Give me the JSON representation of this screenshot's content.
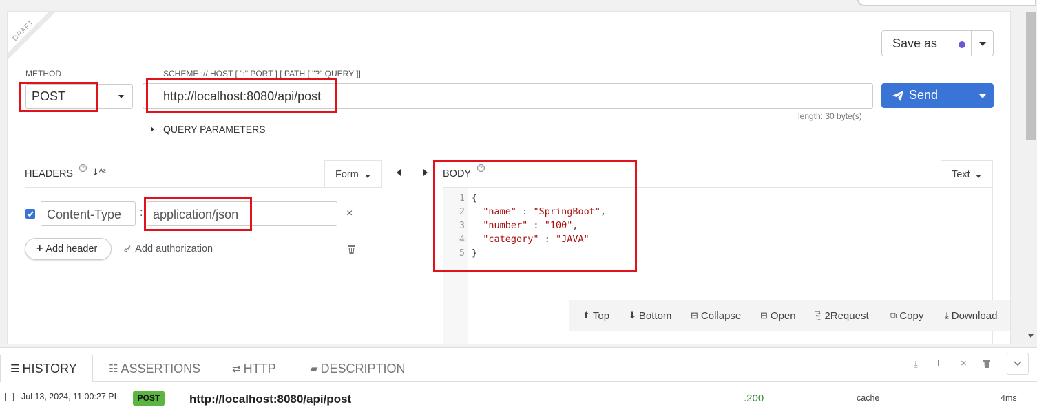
{
  "draft_label": "DRAFT",
  "save": {
    "label": "Save as"
  },
  "method": {
    "label": "METHOD",
    "value": "POST"
  },
  "url": {
    "label": "SCHEME :// HOST [ \":\" PORT ] [ PATH [ \"?\" QUERY ]]",
    "value": "http://localhost:8080/api/post",
    "length": "length: 30 byte(s)"
  },
  "send": {
    "label": "Send"
  },
  "query_params": {
    "label": "QUERY PARAMETERS"
  },
  "headers": {
    "label": "HEADERS",
    "form_label": "Form",
    "rows": [
      {
        "checked": true,
        "name": "Content-Type",
        "value": "application/json"
      }
    ],
    "add_header": "Add header",
    "add_auth": "Add authorization"
  },
  "body": {
    "label": "BODY",
    "text_label": "Text",
    "line_numbers": [
      "1",
      "2",
      "3",
      "4",
      "5"
    ],
    "lines": [
      {
        "text": "{"
      },
      {
        "key": "\"name\"",
        "sep": " : ",
        "value": "\"SpringBoot\"",
        "end": ","
      },
      {
        "key": "\"number\"",
        "sep": " : ",
        "value": "\"100\"",
        "end": ","
      },
      {
        "key": "\"category\"",
        "sep": " : ",
        "value": "\"JAVA\"",
        "end": ""
      },
      {
        "text": "}"
      }
    ]
  },
  "toolbar": {
    "top": "Top",
    "bottom": "Bottom",
    "collapse": "Collapse",
    "open": "Open",
    "to_request": "2Request",
    "copy": "Copy",
    "download": "Download"
  },
  "bottom_tabs": [
    "HISTORY",
    "ASSERTIONS",
    "HTTP",
    "DESCRIPTION"
  ],
  "history": [
    {
      "date": "Jul 13, 2024, 11:00:27 PI",
      "method": "POST",
      "url": "http://localhost:8080/api/post",
      "status": "200",
      "cache": "cache",
      "time": "4ms"
    }
  ],
  "colors": {
    "accent": "#3a74d6",
    "method_badge": "#5cb540",
    "highlight": "#e0121a",
    "dot": "#6a5acd"
  }
}
